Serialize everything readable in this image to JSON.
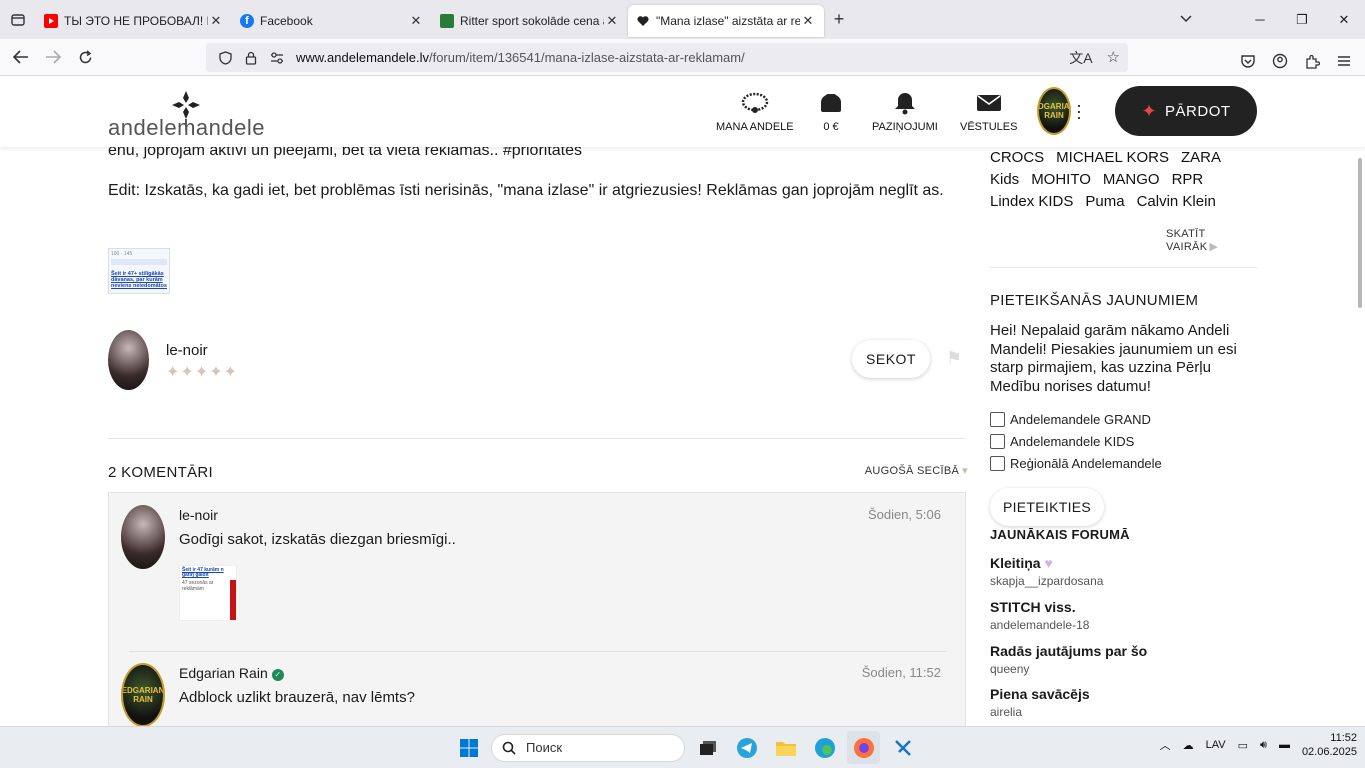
{
  "browser": {
    "tabs": [
      {
        "title": "ТЫ ЭТО НЕ ПРОБОВАЛ! Главны",
        "icon": "youtube-icon",
        "active": false
      },
      {
        "title": "Facebook",
        "icon": "facebook-icon",
        "active": false
      },
      {
        "title": "Ritter sport sokolāde cena aptu",
        "icon": "ritter-icon",
        "active": false
      },
      {
        "title": "\"Mana izlase\" aizstāta ar reklām",
        "icon": "heart-icon",
        "active": true
      }
    ],
    "url_host": "www.andelemandele.lv",
    "url_path": "/forum/item/136541/mana-izlase-aizstata-ar-reklamam/"
  },
  "site": {
    "logo": "andelemandele",
    "nav": {
      "mana_andele": "MANA ANDELE",
      "balance": "0 €",
      "notifications": "PAZIŅOJUMI",
      "messages": "VĒSTULES"
    },
    "user_badge": "EDGARIAN RAIN",
    "sell_label": "PĀRDOT"
  },
  "post": {
    "text1": "enu, joprojām aktīvi un pieejami, bet tā vietā reklāmas.. #prioritātes",
    "text2": "Edit: Izskatās, ka gadi iet, bet problēmas īsti nerisinās, \"mana izlase\" ir atgriezusies! Reklāmas gan joprojām neglīt as.",
    "thumb_text": "Šeit ir 47+ stilīgākās dāvanas, par kurām neviens neiedomātos",
    "thumb_counts": "100 · 145",
    "author": "le-noir",
    "rating_stars": "✦✦✦✦✦",
    "follow_label": "SEKOT"
  },
  "comments": {
    "title": "2 KOMENTĀRI",
    "sort_label": "AUGOŠĀ SECĪBĀ",
    "items": [
      {
        "name": "le-noir",
        "time": "Šodien, 5:06",
        "text": "Godīgi sakot, izskatās diezgan briesmīgi..",
        "thumb_text": "Šeit ir 47 kurām n gatiŋ gaidīt",
        "thumb_sub": "47 sezonās ar reklāmām"
      },
      {
        "name": "Edgarian Rain",
        "time": "Šodien, 11:52",
        "text": "Adblock uzlikt brauzerā, nav lēmts?"
      }
    ]
  },
  "sidebar": {
    "brands_line1": [
      "CROCS",
      "MICHAEL KORS",
      "ZARA"
    ],
    "brands_line2": [
      "Kids",
      "MOHITO",
      "MANGO",
      "RPR"
    ],
    "brands_line3": [
      "Lindex KIDS",
      "Puma",
      "Calvin Klein"
    ],
    "see_more": "SKATĪT VAIRĀK",
    "newsletter_title": "PIETEIKŠANĀS JAUNUMIEM",
    "newsletter_text": "Hei! Nepalaid garām nākamo Andeli Mandeli! Piesakies jaunumiem un esi starp pirmajiem, kas uzzina Pērļu Medību norises datumu!",
    "options": [
      "Andelemandele GRAND",
      "Andelemandele KIDS",
      "Reģionālā Andelemandele"
    ],
    "subscribe_label": "PIETEIKTIES",
    "forum_title": "JAUNĀKAIS FORUMĀ",
    "forum": [
      {
        "title": "Kleitiņa",
        "user": "skapja__izpardosana"
      },
      {
        "title": "STITCH viss.",
        "user": "andelemandele-18"
      },
      {
        "title": "Radās jautājums par šo",
        "user": "queeny"
      },
      {
        "title": "Piena savācējs",
        "user": "airelia"
      }
    ]
  },
  "taskbar": {
    "search_placeholder": "Поиск",
    "lang": "LAV",
    "time": "11:52",
    "date": "02.06.2025"
  },
  "colors": {
    "accent": "#e24747",
    "dark_button": "#222222",
    "verified": "#1d8a5a"
  }
}
